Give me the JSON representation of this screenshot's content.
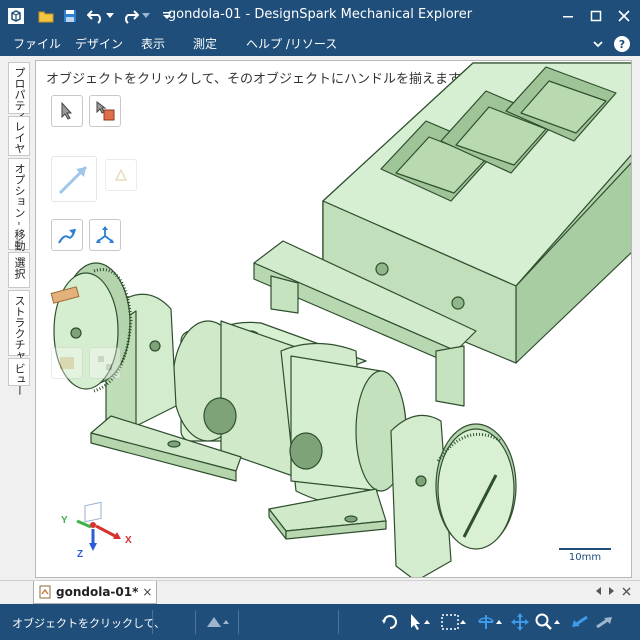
{
  "window": {
    "title": "gondola-01 - DesignSpark Mechanical Explorer"
  },
  "menu": {
    "items": [
      "ファイル",
      "デザイン",
      "表示",
      "測定",
      "ヘルプ /リソース"
    ]
  },
  "side_panel": {
    "tabs": [
      "プロパティ",
      "レイヤ",
      "オプション - 移動",
      "選択",
      "ストラクチャー",
      "ビュー"
    ]
  },
  "viewport": {
    "hint": "オブジェクトをクリックして、そのオブジェクトにハンドルを揃えます",
    "triad": {
      "x_label": "X",
      "y_label": "Y",
      "z_label": "Z"
    },
    "scale_label": "10mm"
  },
  "document_tabs": [
    {
      "label": "gondola-01*",
      "close": "×"
    }
  ],
  "status": {
    "text": "オブジェクトをクリックして、"
  },
  "colors": {
    "chrome": "#1e4e79",
    "model_fill": "#cfe9c9",
    "model_edge": "#2f4f2f",
    "scale_bar": "#1e4e79"
  }
}
